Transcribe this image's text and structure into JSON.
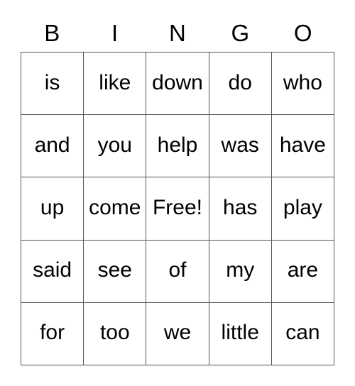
{
  "card": {
    "title": "BINGO",
    "headers": [
      "B",
      "I",
      "N",
      "G",
      "O"
    ],
    "free_space_label": "Free!",
    "colors": {
      "background": "#ffffff",
      "text": "#000000",
      "border": "#555555"
    },
    "rows": [
      {
        "cells": [
          "is",
          "like",
          "down",
          "do",
          "who"
        ]
      },
      {
        "cells": [
          "and",
          "you",
          "help",
          "was",
          "have"
        ]
      },
      {
        "cells": [
          "up",
          "come",
          "Free!",
          "has",
          "play"
        ]
      },
      {
        "cells": [
          "said",
          "see",
          "of",
          "my",
          "are"
        ]
      },
      {
        "cells": [
          "for",
          "too",
          "we",
          "little",
          "can"
        ]
      }
    ]
  }
}
